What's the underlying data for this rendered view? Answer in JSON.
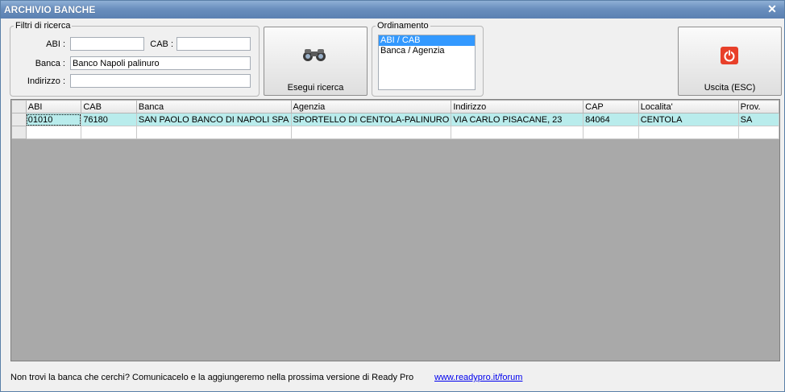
{
  "window": {
    "title": "ARCHIVIO BANCHE",
    "close_glyph": "✕"
  },
  "filters": {
    "legend": "Filtri di ricerca",
    "abi_label": "ABI :",
    "abi_value": "",
    "cab_label": "CAB :",
    "cab_value": "",
    "banca_label": "Banca :",
    "banca_value": "Banco Napoli palinuro",
    "indirizzo_label": "Indirizzo :",
    "indirizzo_value": ""
  },
  "search_button": {
    "label": "Esegui ricerca",
    "icon": "binoculars-icon"
  },
  "ordering": {
    "legend": "Ordinamento",
    "options": [
      "ABI / CAB",
      "Banca / Agenzia"
    ],
    "selected": 0
  },
  "exit_button": {
    "label": "Uscita (ESC)",
    "icon": "power-icon",
    "icon_color": "#e8402a"
  },
  "table": {
    "columns": [
      "ABI",
      "CAB",
      "Banca",
      "Agenzia",
      "Indirizzo",
      "CAP",
      "Localita'",
      "Prov."
    ],
    "rows": [
      [
        "01010",
        "76180",
        "SAN PAOLO BANCO DI NAPOLI SPA",
        "SPORTELLO DI CENTOLA-PALINURO",
        "VIA CARLO PISACANE, 23",
        "84064",
        "CENTOLA",
        "SA"
      ]
    ],
    "selected_row_color": "#b9ecec"
  },
  "footer": {
    "message": "Non trovi la banca che cerchi? Comunicacelo e la aggiungeremo nella prossima versione di Ready Pro",
    "link": "www.readypro.it/forum"
  }
}
